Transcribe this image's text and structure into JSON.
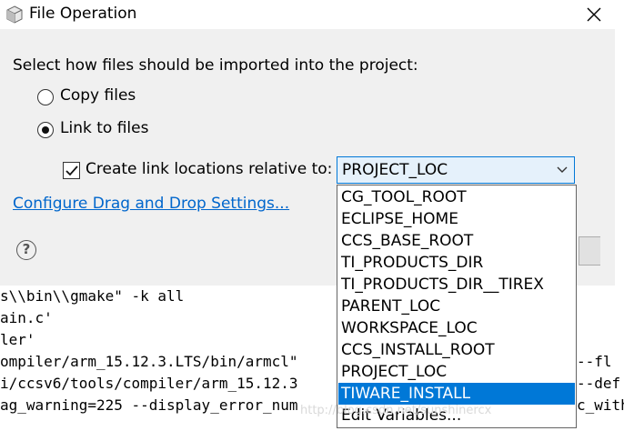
{
  "console": {
    "lines": [
      "s\\\\bin\\\\gmake\" -k all",
      "ain.c'",
      "ler'",
      "ompiler/arm_15.12.3.LTS/bin/armcl\"",
      "i/ccsv6/tools/compiler/arm_15.12.3",
      "ag_warning=225 --display_error_num"
    ],
    "right_fragments": [
      "--fl",
      "--def",
      "c_with"
    ]
  },
  "watermark": "http://blog.csdn.net/sunshinercx",
  "dialog": {
    "title": "File Operation",
    "prompt": "Select how files should be imported into the project:",
    "options": {
      "copy": "Copy files",
      "link": "Link to files",
      "selected": "link"
    },
    "create_link": {
      "label": "Create link locations relative to:",
      "checked": true
    },
    "combo": {
      "value": "PROJECT_LOC",
      "options": [
        "CG_TOOL_ROOT",
        "ECLIPSE_HOME",
        "CCS_BASE_ROOT",
        "TI_PRODUCTS_DIR",
        "TI_PRODUCTS_DIR__TIREX",
        "PARENT_LOC",
        "WORKSPACE_LOC",
        "CCS_INSTALL_ROOT",
        "PROJECT_LOC",
        "TIWARE_INSTALL",
        "Edit Variables..."
      ],
      "highlighted": "TIWARE_INSTALL"
    },
    "settings_link": "Configure Drag and Drop Settings...",
    "help_glyph": "?"
  },
  "colors": {
    "accent": "#0078d7",
    "link": "#0066cc",
    "combo_bg": "#e5f1fb"
  }
}
